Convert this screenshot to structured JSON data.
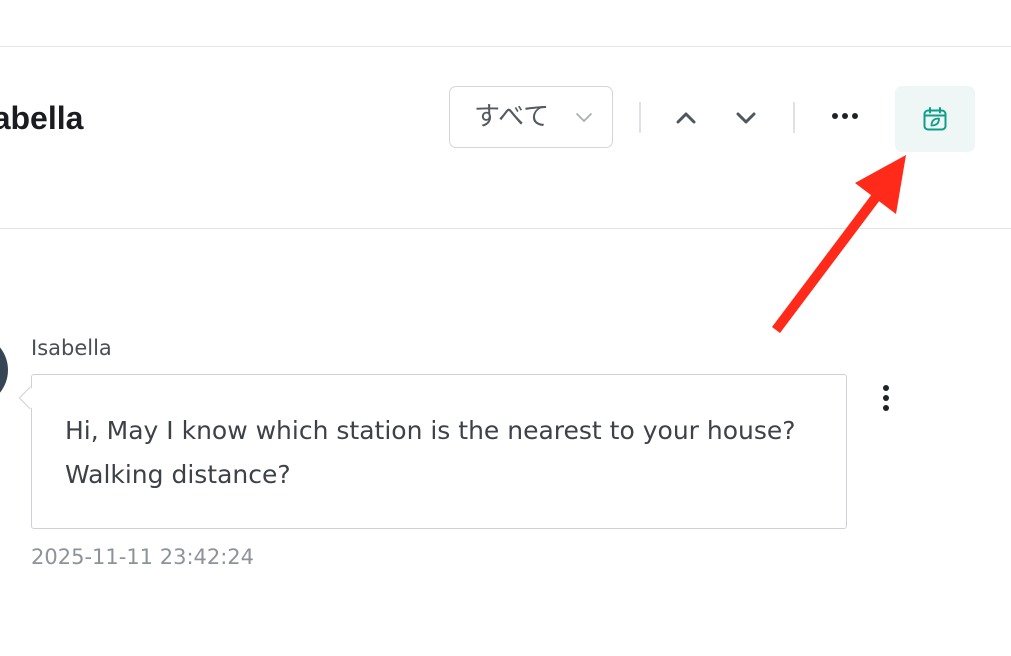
{
  "header": {
    "contact_name": "Isabella",
    "filter": {
      "selected": "すべて"
    },
    "icons": {
      "prev": "chevron-up-icon",
      "next": "chevron-down-icon",
      "more": "more-horizontal-icon",
      "calendar": "calendar-icon"
    },
    "accent_color": "#0f9e8a",
    "highlight_bg": "#eef7f5"
  },
  "annotation": {
    "arrow_color": "#ff2a1a"
  },
  "messages": [
    {
      "sender": "Isabella",
      "text_line1": "Hi, May I know which station is the nearest to your house?",
      "text_line2": "Walking distance?",
      "timestamp": "2025-11-11 23:42:24"
    }
  ]
}
